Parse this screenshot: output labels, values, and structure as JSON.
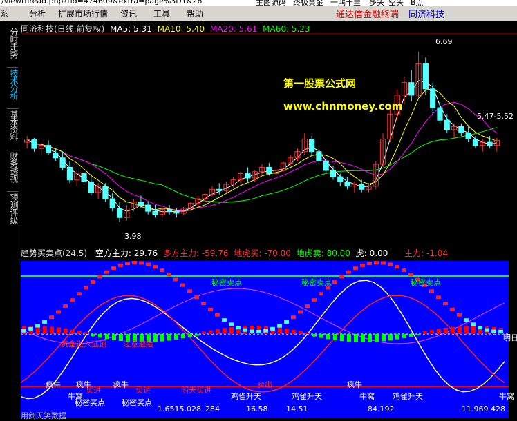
{
  "address": {
    "url": "/viewthread.php?tid=474609&extra=page%3D1&26",
    "links": [
      "主图源码",
      "终极黄金",
      "一鸿千里",
      "多头",
      "空头",
      "B点"
    ]
  },
  "menu": {
    "items": [
      "分析",
      "扩展市场行情",
      "资讯",
      "工具",
      "帮助"
    ],
    "brand_red": "通达信金融终端",
    "brand_blue": "同济科技"
  },
  "left_tabs": [
    {
      "label": "分时走势",
      "active": false
    },
    {
      "label": "技术分析",
      "active": true
    },
    {
      "label": "基本资料",
      "active": false
    },
    {
      "label": "财务透视",
      "active": false
    },
    {
      "label": "预测评级",
      "active": false
    }
  ],
  "main_header": {
    "title": "同济科技(日线,前复权)",
    "ma5": "MA5: 5.31",
    "ma10": "MA10: 5.40",
    "ma20": "MA20: 5.61",
    "ma60": "MA60: 5.23",
    "colors": {
      "ma5": "#ffffff",
      "ma10": "#ffff00",
      "ma20": "#ff00ff",
      "ma60": "#00ff00"
    }
  },
  "watermark": {
    "line1": "第一股票公式网",
    "line2": "www.chnmoney.com"
  },
  "price_labels": {
    "high": "6.69",
    "low": "3.98",
    "range": "5.47-5.52"
  },
  "sub_header": {
    "name": "趋势买卖点(24,5)",
    "kongfang": "空方主力: 29.76",
    "duofang": "多方主力: -59.76",
    "dihu_buy": "地虎买: -70.00",
    "dihu_sell": "地虎卖: 80.00",
    "hu": "虎: 0.00",
    "zhuli": "主力: -1.04"
  },
  "sub_labels": {
    "sell_signal": "秘密卖点",
    "left_signals": "资金进入逃顶",
    "abort": "注意避险",
    "niu": "疯牛",
    "niu2": "疯牛",
    "niu3": "疯牛",
    "buy_in": "买进",
    "bright_buy": "明天买进",
    "secret_buy1": "秘密买点",
    "secret_buy2": "秘密买点",
    "que1": "鸡雀升天",
    "que2": "鸡雀升天",
    "que3": "鸡雀升天",
    "niuwo1": "牛窝",
    "niuwo2": "牛窝",
    "niuwo3": "牛窝",
    "right_bright": "明日",
    "bottom_vals": [
      "1.6515.028",
      "284",
      "16.58",
      "14.51",
      "84.192",
      "11.969",
      "428"
    ],
    "bottom_note": "用剑天笑数据",
    "top_sell": "卖出"
  },
  "chart_data": {
    "type": "candlestick",
    "title": "同济科技(日线,前复权)",
    "ylim": [
      3.8,
      6.9
    ],
    "candles": [
      [
        5.25,
        5.35,
        5.15,
        5.3
      ],
      [
        5.3,
        5.32,
        5.1,
        5.15
      ],
      [
        5.15,
        5.25,
        5.05,
        5.2
      ],
      [
        5.2,
        5.28,
        5.05,
        5.08
      ],
      [
        5.08,
        5.15,
        4.95,
        5.0
      ],
      [
        5.0,
        5.1,
        4.8,
        4.85
      ],
      [
        4.85,
        4.95,
        4.6,
        4.65
      ],
      [
        4.65,
        4.8,
        4.55,
        4.75
      ],
      [
        4.75,
        4.85,
        4.6,
        4.62
      ],
      [
        4.62,
        4.7,
        4.4,
        4.45
      ],
      [
        4.45,
        4.6,
        4.35,
        4.55
      ],
      [
        4.55,
        4.6,
        4.3,
        4.35
      ],
      [
        4.35,
        4.45,
        4.15,
        4.2
      ],
      [
        4.2,
        4.3,
        3.98,
        4.05
      ],
      [
        4.05,
        4.25,
        4.0,
        4.2
      ],
      [
        4.2,
        4.35,
        4.15,
        4.3
      ],
      [
        4.3,
        4.4,
        4.2,
        4.25
      ],
      [
        4.25,
        4.3,
        4.1,
        4.15
      ],
      [
        4.15,
        4.25,
        4.05,
        4.1
      ],
      [
        4.1,
        4.2,
        4.05,
        4.18
      ],
      [
        4.18,
        4.25,
        4.1,
        4.15
      ],
      [
        4.15,
        4.2,
        4.05,
        4.12
      ],
      [
        4.12,
        4.22,
        4.08,
        4.2
      ],
      [
        4.2,
        4.3,
        4.15,
        4.28
      ],
      [
        4.28,
        4.4,
        4.22,
        4.35
      ],
      [
        4.35,
        4.45,
        4.3,
        4.42
      ],
      [
        4.42,
        4.55,
        4.38,
        4.5
      ],
      [
        4.5,
        4.6,
        4.42,
        4.48
      ],
      [
        4.48,
        4.62,
        4.45,
        4.58
      ],
      [
        4.58,
        4.7,
        4.52,
        4.65
      ],
      [
        4.65,
        4.78,
        4.6,
        4.75
      ],
      [
        4.75,
        4.85,
        4.62,
        4.68
      ],
      [
        4.68,
        4.8,
        4.62,
        4.78
      ],
      [
        4.78,
        4.9,
        4.72,
        4.85
      ],
      [
        4.85,
        4.92,
        4.72,
        4.75
      ],
      [
        4.75,
        4.85,
        4.68,
        4.8
      ],
      [
        4.8,
        4.95,
        4.78,
        4.92
      ],
      [
        4.92,
        5.05,
        4.88,
        5.0
      ],
      [
        5.0,
        5.15,
        4.95,
        5.1
      ],
      [
        5.1,
        5.4,
        5.05,
        5.3
      ],
      [
        5.3,
        5.35,
        5.05,
        5.1
      ],
      [
        5.1,
        5.15,
        4.9,
        4.95
      ],
      [
        4.95,
        5.0,
        4.75,
        4.8
      ],
      [
        4.8,
        4.88,
        4.65,
        4.7
      ],
      [
        4.7,
        4.75,
        4.55,
        4.62
      ],
      [
        4.62,
        4.7,
        4.5,
        4.55
      ],
      [
        4.55,
        4.62,
        4.45,
        4.58
      ],
      [
        4.58,
        4.65,
        4.45,
        4.5
      ],
      [
        4.5,
        4.6,
        4.45,
        4.55
      ],
      [
        4.55,
        4.95,
        4.5,
        4.9
      ],
      [
        4.9,
        5.4,
        4.85,
        5.3
      ],
      [
        5.3,
        5.8,
        5.25,
        5.7
      ],
      [
        5.7,
        6.1,
        5.6,
        6.0
      ],
      [
        6.0,
        6.3,
        5.85,
        6.2
      ],
      [
        6.2,
        6.4,
        5.9,
        6.0
      ],
      [
        6.0,
        6.69,
        5.95,
        6.5
      ],
      [
        6.5,
        6.6,
        6.0,
        6.1
      ],
      [
        6.1,
        6.2,
        5.7,
        5.8
      ],
      [
        5.8,
        5.9,
        5.55,
        5.6
      ],
      [
        5.6,
        5.7,
        5.4,
        5.45
      ],
      [
        5.45,
        5.55,
        5.3,
        5.5
      ],
      [
        5.5,
        5.55,
        5.35,
        5.4
      ],
      [
        5.4,
        5.5,
        5.25,
        5.3
      ],
      [
        5.3,
        5.35,
        5.15,
        5.2
      ],
      [
        5.2,
        5.3,
        5.1,
        5.25
      ],
      [
        5.25,
        5.35,
        5.15,
        5.2
      ],
      [
        5.2,
        5.32,
        5.1,
        5.28
      ]
    ],
    "series_colors": {
      "ma5": "#ffffff",
      "ma10": "#ffff00",
      "ma20": "#ff00ff",
      "ma60": "#00ff00"
    }
  }
}
